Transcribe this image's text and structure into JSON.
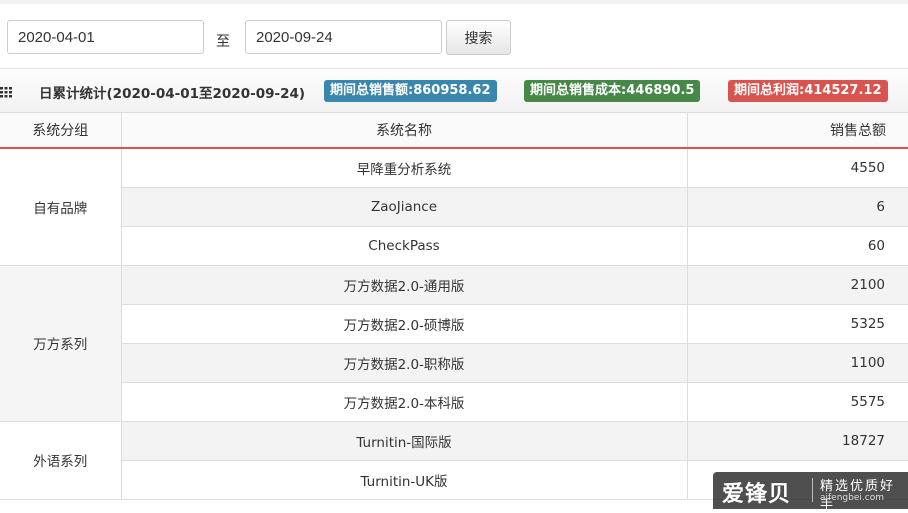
{
  "search": {
    "start_date": "2020-04-01",
    "to_label": "至",
    "end_date": "2020-09-24",
    "button_label": "搜索"
  },
  "stats": {
    "title": "日累计统计(2020-04-01至2020-09-24)",
    "total_sales": "期间总销售额:860958.62",
    "total_cost": "期间总销售成本:446890.5",
    "total_profit": "期间总利润:414527.12"
  },
  "table": {
    "headers": [
      "系统分组",
      "系统名称",
      "销售总额"
    ],
    "groups": [
      {
        "name": "自有品牌",
        "rows": [
          {
            "system": "早降重分析系统",
            "amount": "4550"
          },
          {
            "system": "ZaoJiance",
            "amount": "6"
          },
          {
            "system": "CheckPass",
            "amount": "60"
          }
        ]
      },
      {
        "name": "万方系列",
        "rows": [
          {
            "system": "万方数据2.0-通用版",
            "amount": "2100"
          },
          {
            "system": "万方数据2.0-硕博版",
            "amount": "5325"
          },
          {
            "system": "万方数据2.0-职称版",
            "amount": "1100"
          },
          {
            "system": "万方数据2.0-本科版",
            "amount": "5575"
          }
        ]
      },
      {
        "name": "外语系列",
        "rows": [
          {
            "system": "Turnitin-国际版",
            "amount": "18727"
          },
          {
            "system": "Turnitin-UK版",
            "amount": ""
          }
        ]
      }
    ]
  },
  "watermark": {
    "brand": "爱锋贝",
    "slogan": "精选优质好手",
    "domain": "aifengbei.com"
  },
  "colors": {
    "sales_badge": "#3a87ad",
    "cost_badge": "#468847",
    "profit_badge": "#d9534f",
    "header_underline": "#d9534f"
  }
}
